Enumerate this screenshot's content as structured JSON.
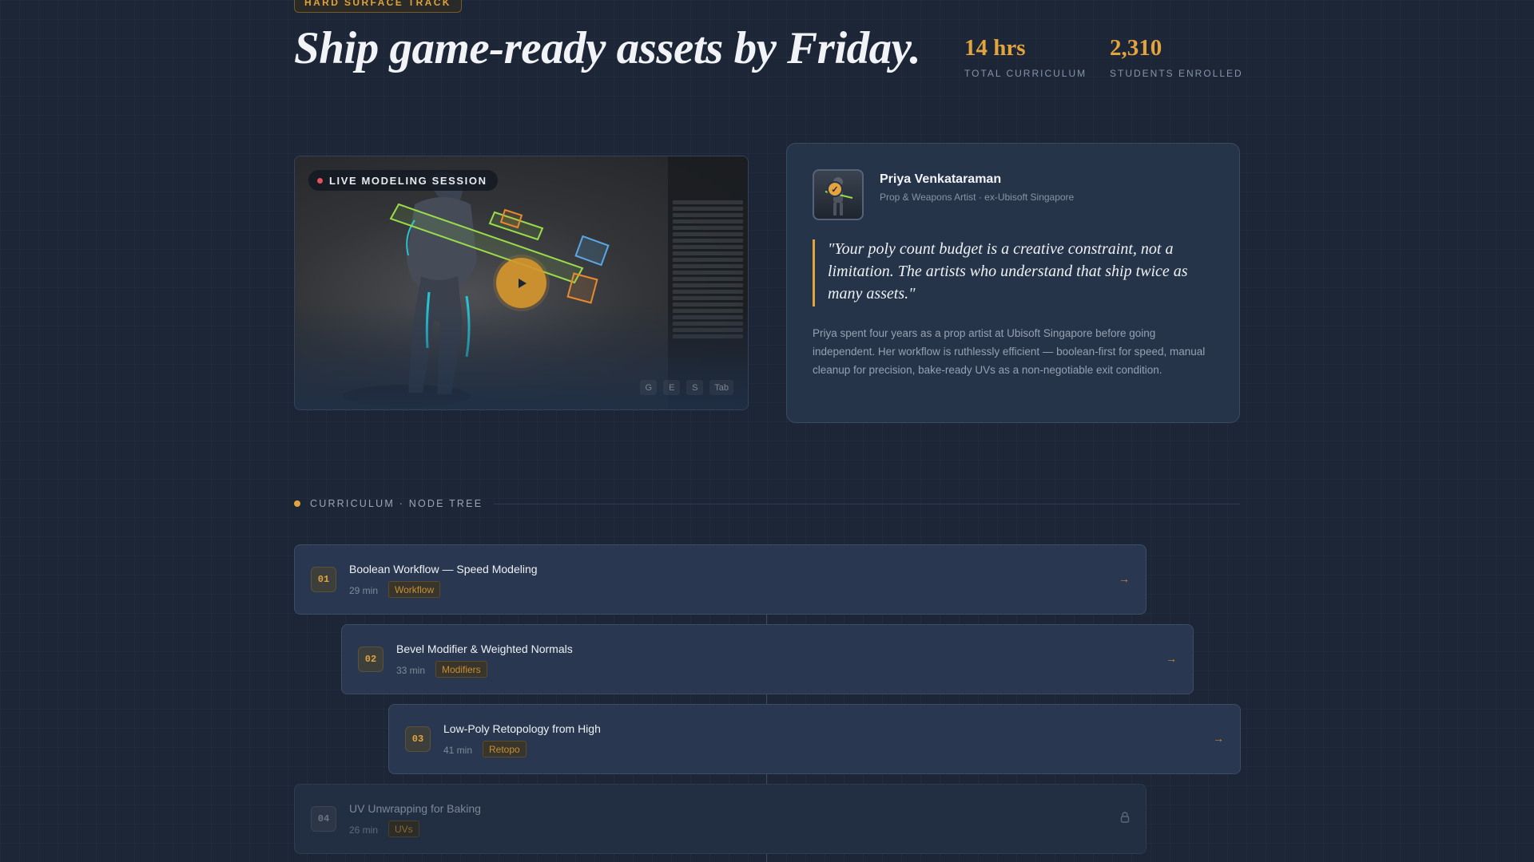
{
  "track_tag": "HARD SURFACE TRACK",
  "headline": "Ship game-ready assets by Friday.",
  "stats": [
    {
      "value": "14 hrs",
      "label": "TOTAL CURRICULUM"
    },
    {
      "value": "2,310",
      "label": "STUDENTS ENROLLED"
    }
  ],
  "video": {
    "badge": "LIVE MODELING SESSION",
    "keys": [
      "G",
      "E",
      "S",
      "Tab"
    ]
  },
  "instructor": {
    "name": "Priya Venkataraman",
    "role": "Prop & Weapons Artist · ex-Ubisoft Singapore",
    "quote": "\"Your poly count budget is a creative constraint, not a limitation. The artists who understand that ship twice as many assets.\"",
    "bio": "Priya spent four years as a prop artist at Ubisoft Singapore before going independent. Her workflow is ruthlessly efficient — boolean-first for speed, manual cleanup for precision, bake-ready UVs as a non-negotiable exit condition."
  },
  "curriculum": {
    "label": "CURRICULUM · NODE TREE",
    "lessons": [
      {
        "num": "01",
        "title": "Boolean Workflow — Speed Modeling",
        "duration": "29 min",
        "tag": "Workflow",
        "action_icon": "arrow-right-icon"
      },
      {
        "num": "02",
        "title": "Bevel Modifier & Weighted Normals",
        "duration": "33 min",
        "tag": "Modifiers",
        "action_icon": "arrow-right-icon"
      },
      {
        "num": "03",
        "title": "Low-Poly Retopology from High",
        "duration": "41 min",
        "tag": "Retopo",
        "action_icon": "arrow-right-icon"
      },
      {
        "num": "04",
        "title": "UV Unwrapping for Baking",
        "duration": "26 min",
        "tag": "UVs",
        "action_icon": "lock-icon"
      }
    ]
  },
  "colors": {
    "accent": "#e3a33d",
    "background": "#1c2636",
    "card": "#293850",
    "live": "#e8505b"
  }
}
